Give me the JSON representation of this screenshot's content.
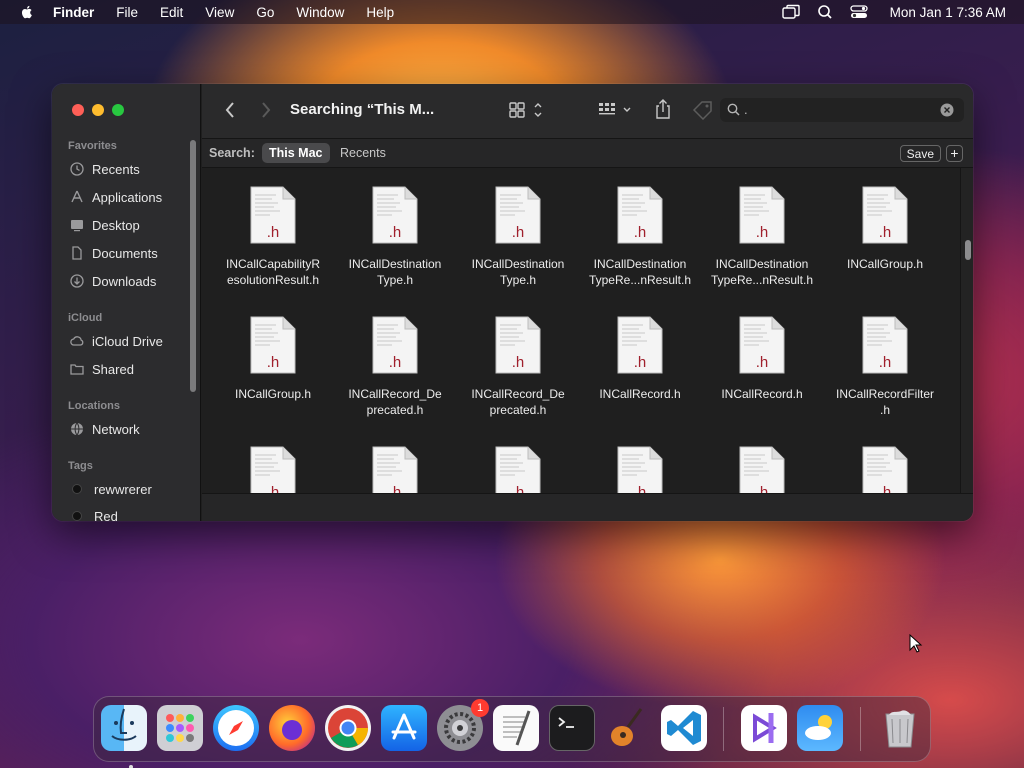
{
  "menubar": {
    "app_name": "Finder",
    "items": [
      "File",
      "Edit",
      "View",
      "Go",
      "Window",
      "Help"
    ],
    "clock": "Mon Jan 1  7:36 AM",
    "icons": [
      "screen-mirroring-icon",
      "spotlight-icon",
      "control-center-icon"
    ]
  },
  "window": {
    "title": "Searching “This M...",
    "sidebar": {
      "favorites_label": "Favorites",
      "favorites": [
        "Recents",
        "Applications",
        "Desktop",
        "Documents",
        "Downloads"
      ],
      "icloud_label": "iCloud",
      "icloud": [
        "iCloud Drive",
        "Shared"
      ],
      "locations_label": "Locations",
      "locations": [
        "Network"
      ],
      "tags_label": "Tags",
      "tags": [
        "rewwrerer",
        "Red"
      ]
    },
    "search": {
      "value": "."
    },
    "scope": {
      "label": "Search:",
      "this_mac": "This Mac",
      "recents": "Recents",
      "save": "Save",
      "add": "+"
    },
    "file_ext": ".h",
    "files": [
      [
        "INCallCapabilityR",
        "esolutionResult.h"
      ],
      [
        "INCallDestination",
        "Type.h"
      ],
      [
        "INCallDestination",
        "Type.h"
      ],
      [
        "INCallDestination",
        "TypeRe...nResult.h"
      ],
      [
        "INCallDestination",
        "TypeRe...nResult.h"
      ],
      [
        "INCallGroup.h",
        ""
      ],
      [
        "INCallGroup.h",
        ""
      ],
      [
        "INCallRecord_De",
        "precated.h"
      ],
      [
        "INCallRecord_De",
        "precated.h"
      ],
      [
        "INCallRecord.h",
        ""
      ],
      [
        "INCallRecord.h",
        ""
      ],
      [
        "INCallRecordFilter",
        ".h"
      ]
    ]
  },
  "dock": {
    "apps": [
      "Finder",
      "Launchpad",
      "Safari",
      "Firefox",
      "Chrome",
      "App Store",
      "System Settings",
      "TextEdit",
      "Terminal",
      "GarageBand",
      "Visual Studio Code",
      "Visual Studio",
      "Weather",
      "Trash"
    ],
    "settings_badge": "1"
  },
  "colors": {
    "window_bg": "#1f1f1f",
    "sidebar_bg": "#2c2c2e",
    "file_ext": "#a0202c",
    "close": "#fe5f57",
    "minimize": "#febc2e",
    "maximize": "#28c840"
  }
}
